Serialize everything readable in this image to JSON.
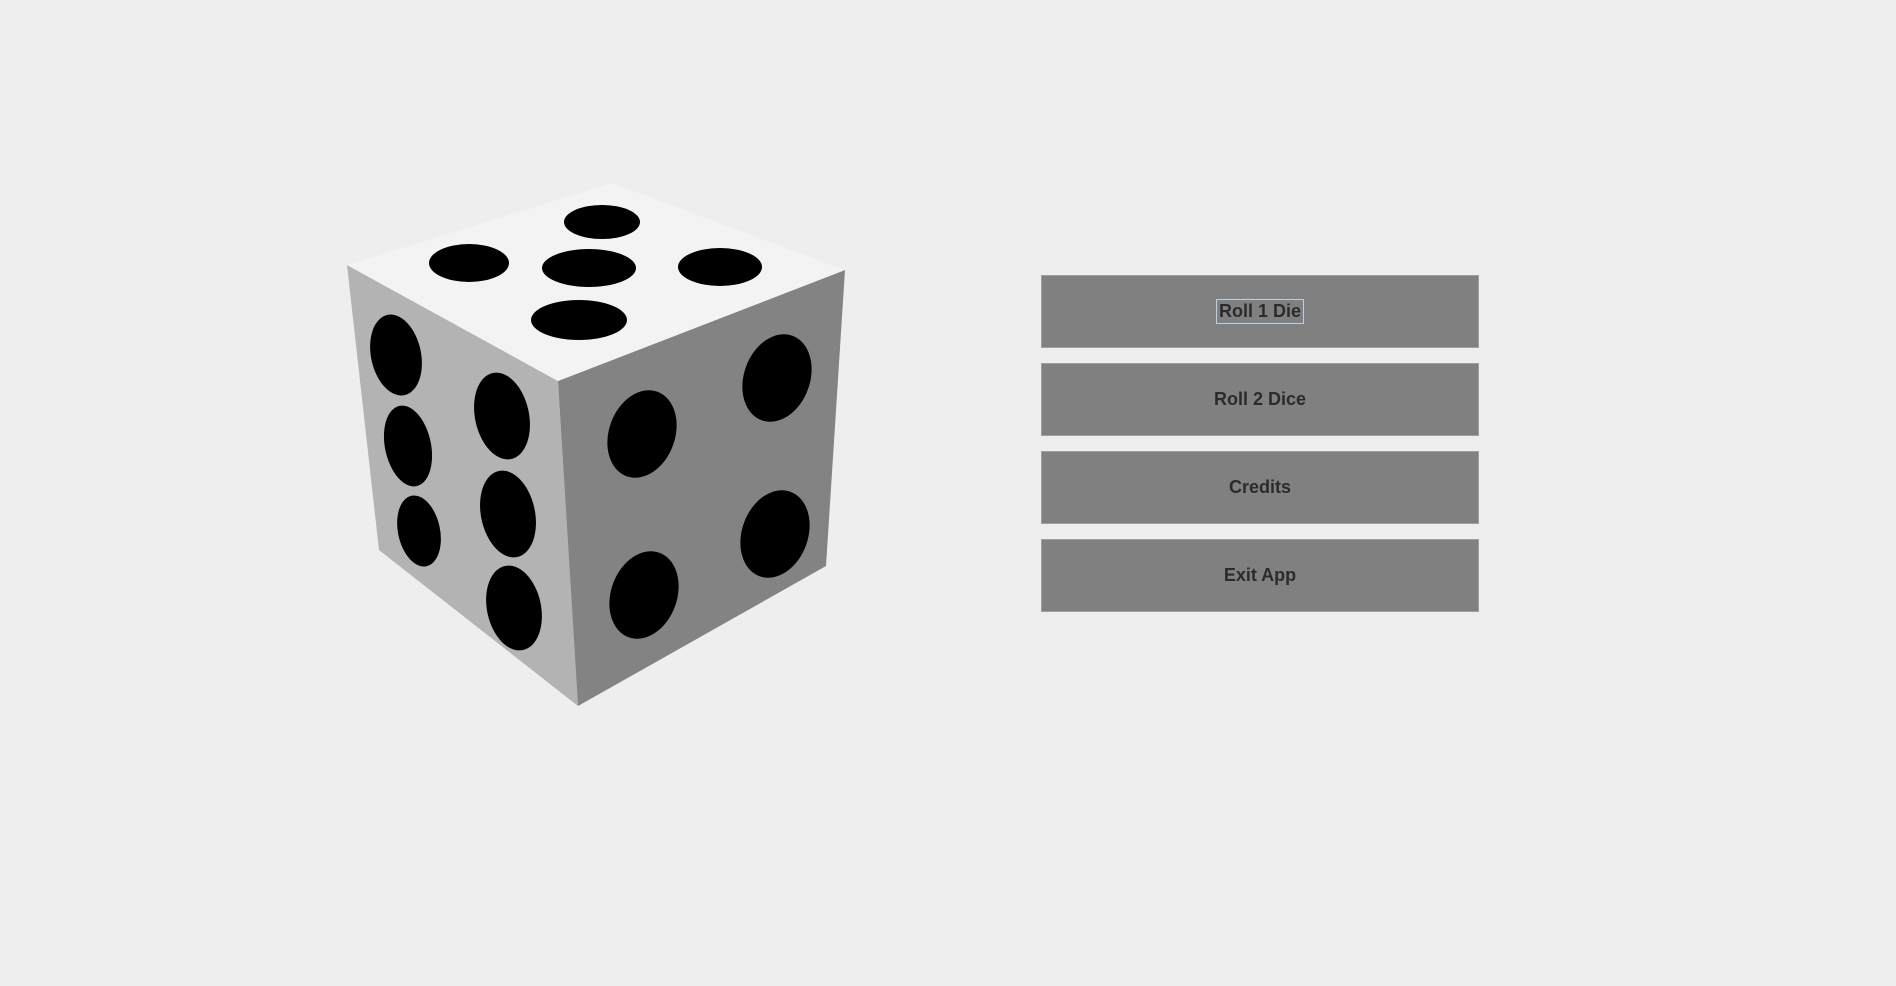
{
  "logo": {
    "icon": "die-five-icon",
    "top_face": "#f3f3f3",
    "left_face": "#b3b3b3",
    "right_face": "#838383",
    "pip": "#000000"
  },
  "menu": {
    "focused": "Roll 1 Die",
    "buttons": [
      {
        "label": "Roll 1 Die"
      },
      {
        "label": "Roll 2 Dice"
      },
      {
        "label": "Credits"
      },
      {
        "label": "Exit App"
      }
    ],
    "button_color": "#808080",
    "background": "#eeeeee"
  }
}
